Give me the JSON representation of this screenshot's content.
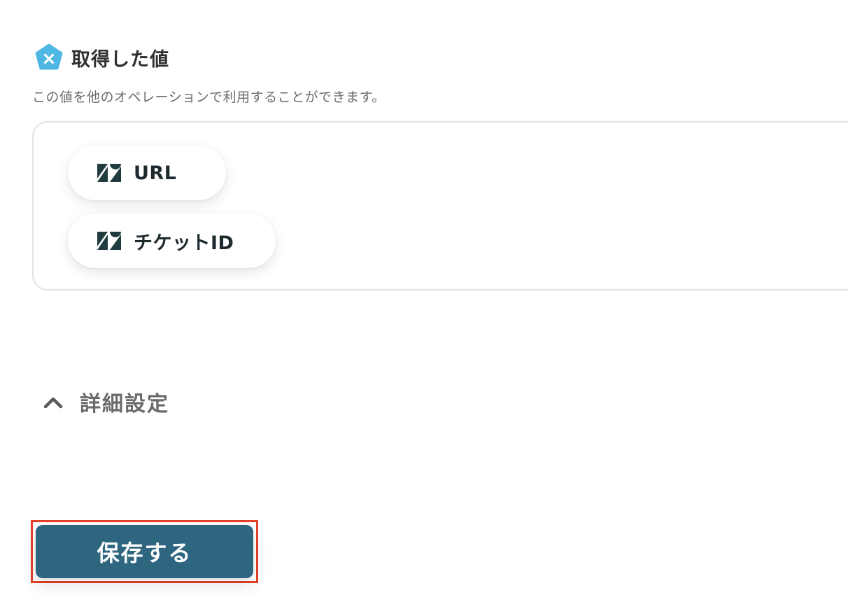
{
  "section": {
    "title": "取得した値",
    "description": "この値を他のオペレーションで利用することができます。",
    "icon": "yoom-pentagon-icon",
    "icon_color": "#4fb7e3"
  },
  "values": [
    {
      "label": "URL",
      "icon": "zendesk-icon"
    },
    {
      "label": "チケットID",
      "icon": "zendesk-icon"
    }
  ],
  "details": {
    "label": "詳細設定",
    "icon": "chevron-up-icon",
    "expanded": true
  },
  "save": {
    "label": "保存する",
    "color": "#2e6680",
    "highlight_color": "#e4412b"
  }
}
